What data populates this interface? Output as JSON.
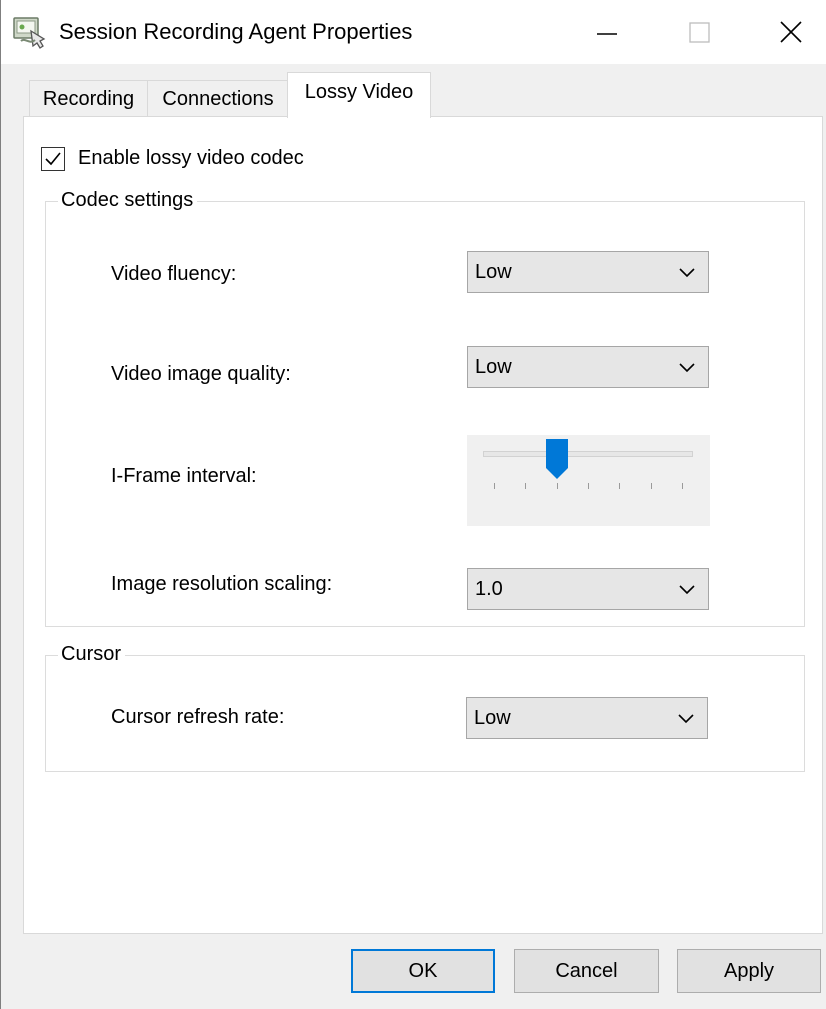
{
  "window": {
    "title": "Session Recording Agent Properties"
  },
  "tabs": [
    {
      "label": "Recording",
      "active": false
    },
    {
      "label": "Connections",
      "active": false
    },
    {
      "label": "Lossy Video",
      "active": true
    }
  ],
  "lossy_video": {
    "enable_checkbox": {
      "label": "Enable lossy video codec",
      "checked": true
    },
    "codec_settings": {
      "legend": "Codec settings",
      "video_fluency": {
        "label": "Video fluency:",
        "value": "Low"
      },
      "video_image_quality": {
        "label": "Video image quality:",
        "value": "Low"
      },
      "iframe_interval": {
        "label": "I-Frame interval:",
        "position": 3,
        "tick_count": 7
      },
      "image_resolution_scaling": {
        "label": "Image resolution scaling:",
        "value": "1.0"
      }
    },
    "cursor": {
      "legend": "Cursor",
      "cursor_refresh_rate": {
        "label": "Cursor refresh rate:",
        "value": "Low"
      }
    }
  },
  "buttons": {
    "ok": "OK",
    "cancel": "Cancel",
    "apply": "Apply"
  },
  "colors": {
    "accent": "#0078d7",
    "window_bg": "#f0f0f0",
    "panel_bg": "#ffffff"
  },
  "icons": {
    "app": "session-recording-agent-icon",
    "minimize": "minimize-icon",
    "maximize": "maximize-icon",
    "close": "close-icon",
    "dropdown": "chevron-down-icon"
  }
}
